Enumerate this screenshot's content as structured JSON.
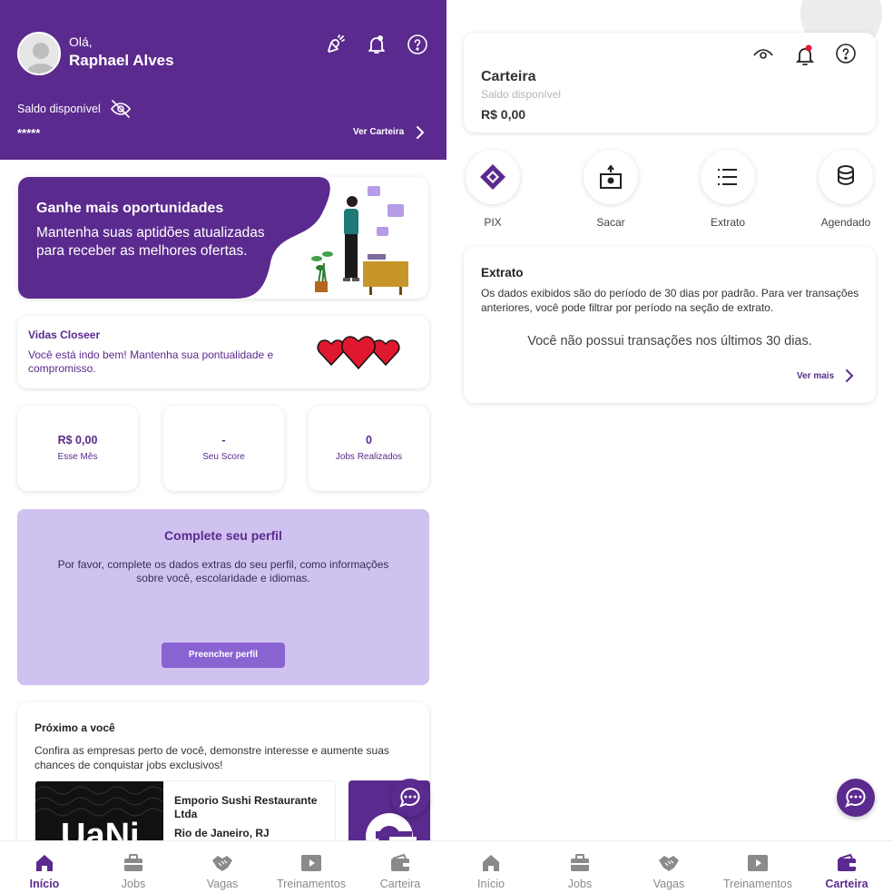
{
  "left": {
    "header": {
      "greeting": "Olá,",
      "user_name": "Raphael Alves",
      "balance_label": "Saldo disponível",
      "balance_hidden": "*****",
      "wallet_link": "Ver Carteira",
      "icons": [
        "megaphone-icon",
        "bell-icon",
        "help-icon",
        "eye-off-icon"
      ]
    },
    "banner": {
      "title": "Ganhe mais oportunidades",
      "text": "Mantenha suas aptidões atualizadas para receber as melhores ofertas."
    },
    "vidas": {
      "title": "Vidas Closeer",
      "text": "Você está indo bem! Mantenha sua pontualidade e compromisso.",
      "lives": 3
    },
    "stats": [
      {
        "value": "R$ 0,00",
        "label": "Esse Mês"
      },
      {
        "value": "-",
        "label": "Seu Score"
      },
      {
        "value": "0",
        "label": "Jobs Realizados"
      }
    ],
    "profile": {
      "title": "Complete seu perfil",
      "text": "Por favor, complete os dados extras do seu perfil, como informações sobre você, escolaridade e idiomas.",
      "button": "Preencher perfil"
    },
    "nearby": {
      "title": "Próximo a você",
      "text": "Confira as empresas perto de você, demonstre interesse e aumente suas chances de conquistar jobs exclusivos!",
      "business_name": "Emporio Sushi Restaurante Ltda",
      "business_city": "Rio de Janeiro, RJ",
      "business_logo_text": "UaNi"
    }
  },
  "right": {
    "wallet": {
      "title": "Carteira",
      "balance_label": "Saldo disponível",
      "balance_value": "R$ 0,00"
    },
    "actions": [
      {
        "label": "PIX",
        "icon": "pix-icon"
      },
      {
        "label": "Sacar",
        "icon": "withdraw-icon"
      },
      {
        "label": "Extrato",
        "icon": "list-icon"
      },
      {
        "label": "Agendado",
        "icon": "coins-icon"
      }
    ],
    "statement": {
      "title": "Extrato",
      "text": "Os dados exibidos são do período de 30 dias por padrão. Para ver transações anteriores, você pode filtrar por período na seção de extrato.",
      "empty": "Você não possui transações nos últimos 30 dias.",
      "more": "Ver mais"
    }
  },
  "nav": [
    {
      "label": "Início",
      "icon": "home-icon"
    },
    {
      "label": "Jobs",
      "icon": "briefcase-icon"
    },
    {
      "label": "Vagas",
      "icon": "handshake-icon"
    },
    {
      "label": "Treinamentos",
      "icon": "play-icon"
    },
    {
      "label": "Carteira",
      "icon": "wallet-icon"
    }
  ],
  "colors": {
    "primary": "#5b2a8e",
    "light_purple": "#cfc2f0",
    "button": "#8a63d2",
    "heart": "#e0182d"
  }
}
